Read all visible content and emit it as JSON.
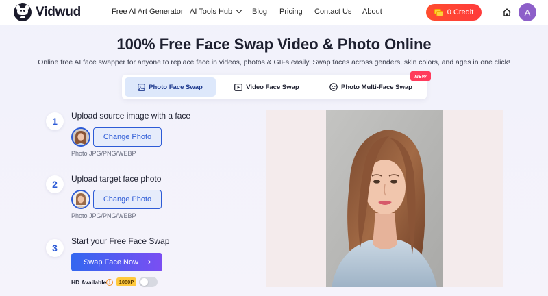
{
  "brand": {
    "name": "Vidwud"
  },
  "nav": {
    "items": [
      {
        "label": "Free AI Art Generator"
      },
      {
        "label": "AI Tools Hub"
      },
      {
        "label": "Blog"
      },
      {
        "label": "Pricing"
      },
      {
        "label": "Contact Us"
      },
      {
        "label": "About"
      }
    ],
    "credit_label": "0 Credit",
    "avatar_letter": "A",
    "home_icon": "home-icon"
  },
  "hero": {
    "title": "100% Free Face Swap Video & Photo Online",
    "subtitle": "Online free AI face swapper for anyone to replace face in videos, photos & GIFs easily. Swap faces across genders, skin colors, and ages in one click!"
  },
  "tabs": [
    {
      "label": "Photo Face Swap",
      "icon": "image-icon",
      "active": true
    },
    {
      "label": "Video Face Swap",
      "icon": "video-icon",
      "active": false
    },
    {
      "label": "Photo Multi-Face Swap",
      "icon": "multi-face-icon",
      "active": false
    }
  ],
  "new_badge": "NEW",
  "steps": [
    {
      "number": "1",
      "title": "Upload source image with a face",
      "button": "Change Photo",
      "hint": "Photo JPG/PNG/WEBP"
    },
    {
      "number": "2",
      "title": "Upload target face photo",
      "button": "Change Photo",
      "hint": "Photo JPG/PNG/WEBP"
    },
    {
      "number": "3",
      "title": "Start your Free Face Swap"
    }
  ],
  "swap_button": "Swap Face Now",
  "hd": {
    "label": "HD Available",
    "resolution": "1080P",
    "enabled": false
  },
  "colors": {
    "accent": "#2d5bd6",
    "credit_button": "#ff4d2e",
    "avatar": "#8d5fc9",
    "new_badge": "#ff3b5c",
    "swap_gradient_start": "#3367f0",
    "swap_gradient_end": "#7b4ef2",
    "resolution_badge": "#ffc93c"
  }
}
